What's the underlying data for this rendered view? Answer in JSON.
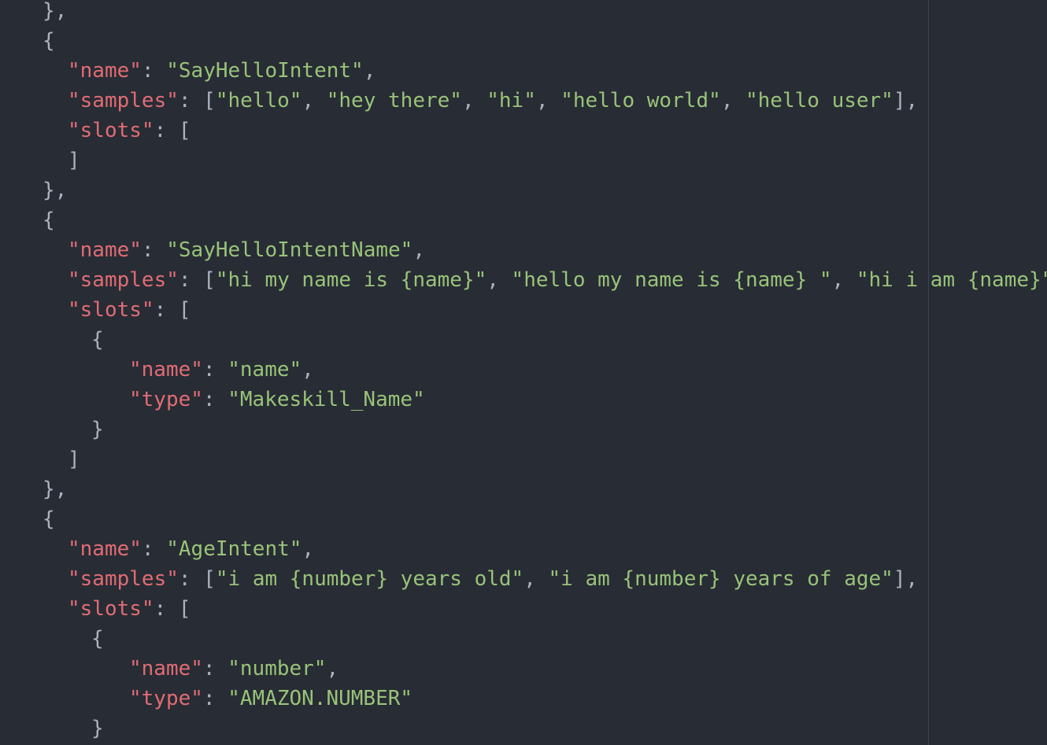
{
  "colors": {
    "background": "#282c34",
    "key": "#e06c75",
    "string": "#98c379",
    "punctuation": "#abb2bf",
    "wrap_guide": "#3e4451"
  },
  "lines": [
    {
      "indent": 1,
      "tokens": [
        [
          "p",
          "},"
        ]
      ]
    },
    {
      "indent": 1,
      "tokens": [
        [
          "p",
          "{"
        ]
      ]
    },
    {
      "indent": 2,
      "tokens": [
        [
          "k",
          "\"name\""
        ],
        [
          "p",
          ": "
        ],
        [
          "s",
          "\"SayHelloIntent\""
        ],
        [
          "p",
          ","
        ]
      ]
    },
    {
      "indent": 2,
      "tokens": [
        [
          "k",
          "\"samples\""
        ],
        [
          "p",
          ": ["
        ],
        [
          "s",
          "\"hello\""
        ],
        [
          "p",
          ", "
        ],
        [
          "s",
          "\"hey there\""
        ],
        [
          "p",
          ", "
        ],
        [
          "s",
          "\"hi\""
        ],
        [
          "p",
          ", "
        ],
        [
          "s",
          "\"hello world\""
        ],
        [
          "p",
          ", "
        ],
        [
          "s",
          "\"hello user\""
        ],
        [
          "p",
          "],"
        ]
      ]
    },
    {
      "indent": 2,
      "tokens": [
        [
          "k",
          "\"slots\""
        ],
        [
          "p",
          ": ["
        ]
      ]
    },
    {
      "indent": 2,
      "tokens": [
        [
          "p",
          "]"
        ]
      ]
    },
    {
      "indent": 1,
      "tokens": [
        [
          "p",
          "},"
        ]
      ]
    },
    {
      "indent": 1,
      "tokens": [
        [
          "p",
          "{"
        ]
      ]
    },
    {
      "indent": 2,
      "tokens": [
        [
          "k",
          "\"name\""
        ],
        [
          "p",
          ": "
        ],
        [
          "s",
          "\"SayHelloIntentName\""
        ],
        [
          "p",
          ","
        ]
      ]
    },
    {
      "indent": 2,
      "tokens": [
        [
          "k",
          "\"samples\""
        ],
        [
          "p",
          ": ["
        ],
        [
          "s",
          "\"hi my name is {name}\""
        ],
        [
          "p",
          ", "
        ],
        [
          "s",
          "\"hello my name is {name} \""
        ],
        [
          "p",
          ", "
        ],
        [
          "s",
          "\"hi i am {name}\""
        ]
      ]
    },
    {
      "indent": 2,
      "tokens": [
        [
          "k",
          "\"slots\""
        ],
        [
          "p",
          ": ["
        ]
      ]
    },
    {
      "indent": 3,
      "tokens": [
        [
          "p",
          "{"
        ]
      ]
    },
    {
      "indent": 4,
      "tokens": [
        [
          "k",
          "\"name\""
        ],
        [
          "p",
          ": "
        ],
        [
          "s",
          "\"name\""
        ],
        [
          "p",
          ","
        ]
      ]
    },
    {
      "indent": 4,
      "tokens": [
        [
          "k",
          "\"type\""
        ],
        [
          "p",
          ": "
        ],
        [
          "s",
          "\"Makeskill_Name\""
        ]
      ]
    },
    {
      "indent": 3,
      "tokens": [
        [
          "p",
          "}"
        ]
      ]
    },
    {
      "indent": 2,
      "tokens": [
        [
          "p",
          "]"
        ]
      ]
    },
    {
      "indent": 1,
      "tokens": [
        [
          "p",
          "},"
        ]
      ]
    },
    {
      "indent": 1,
      "tokens": [
        [
          "p",
          "{"
        ]
      ]
    },
    {
      "indent": 2,
      "tokens": [
        [
          "k",
          "\"name\""
        ],
        [
          "p",
          ": "
        ],
        [
          "s",
          "\"AgeIntent\""
        ],
        [
          "p",
          ","
        ]
      ]
    },
    {
      "indent": 2,
      "tokens": [
        [
          "k",
          "\"samples\""
        ],
        [
          "p",
          ": ["
        ],
        [
          "s",
          "\"i am {number} years old\""
        ],
        [
          "p",
          ", "
        ],
        [
          "s",
          "\"i am {number} years of age\""
        ],
        [
          "p",
          "],"
        ]
      ]
    },
    {
      "indent": 2,
      "tokens": [
        [
          "k",
          "\"slots\""
        ],
        [
          "p",
          ": ["
        ]
      ]
    },
    {
      "indent": 3,
      "tokens": [
        [
          "p",
          "{"
        ]
      ]
    },
    {
      "indent": 4,
      "tokens": [
        [
          "k",
          "\"name\""
        ],
        [
          "p",
          ": "
        ],
        [
          "s",
          "\"number\""
        ],
        [
          "p",
          ","
        ]
      ]
    },
    {
      "indent": 4,
      "tokens": [
        [
          "k",
          "\"type\""
        ],
        [
          "p",
          ": "
        ],
        [
          "s",
          "\"AMAZON.NUMBER\""
        ]
      ]
    },
    {
      "indent": 3,
      "tokens": [
        [
          "p",
          "}"
        ]
      ]
    }
  ]
}
